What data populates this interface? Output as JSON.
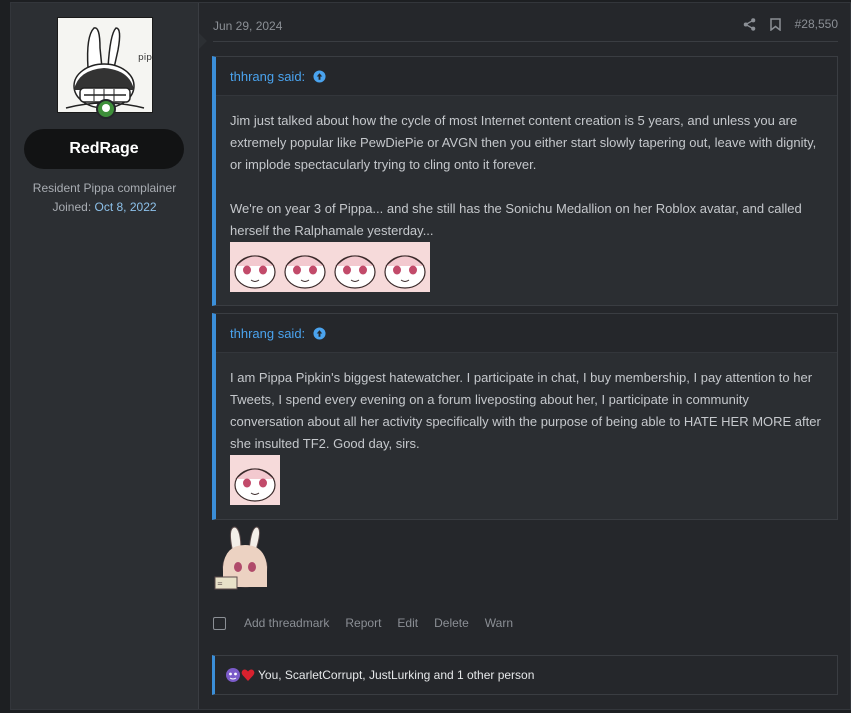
{
  "user": {
    "username": "RedRage",
    "title": "Resident Pippa complainer",
    "joined_label": "Joined:",
    "joined_date": "Oct 8, 2022"
  },
  "post": {
    "date": "Jun 29, 2024",
    "number": "#28,550",
    "quotes": [
      {
        "author": "thhrang said:",
        "paragraphs": [
          "Jim just talked about how the cycle of most Internet content creation is 5 years, and unless you are extremely popular like PewDiePie or AVGN then you either start slowly tapering out, leave with dignity, or implode spectacularly trying to cling onto it forever.",
          "We're on year 3 of Pippa... and she still has the Sonichu Medallion on her Roblox avatar, and called herself the Ralphamale yesterday..."
        ],
        "emote_count": 4
      },
      {
        "author": "thhrang said:",
        "paragraphs": [
          "I am Pippa Pipkin's biggest hatewatcher. I participate in chat, I buy membership, I pay attention to her Tweets, I spend every evening on a forum liveposting about her, I participate in community conversation about all her activity specifically with the purpose of being able to HATE HER MORE after she insulted TF2. Good day, sirs."
        ],
        "emote_count": 1
      }
    ]
  },
  "actions": {
    "threadmark": "Add threadmark",
    "report": "Report",
    "edit": "Edit",
    "delete": "Delete",
    "warn": "Warn"
  },
  "reactions": {
    "text": "You, ScarletCorrupt, JustLurking and 1 other person"
  },
  "icons": {
    "share": "share-icon",
    "bookmark": "bookmark-icon",
    "quote_arrow": "arrow-up-circle-icon"
  },
  "colors": {
    "accent": "#3b8ed8",
    "link": "#4aa3ee",
    "joined_date": "#8dc1ea"
  }
}
